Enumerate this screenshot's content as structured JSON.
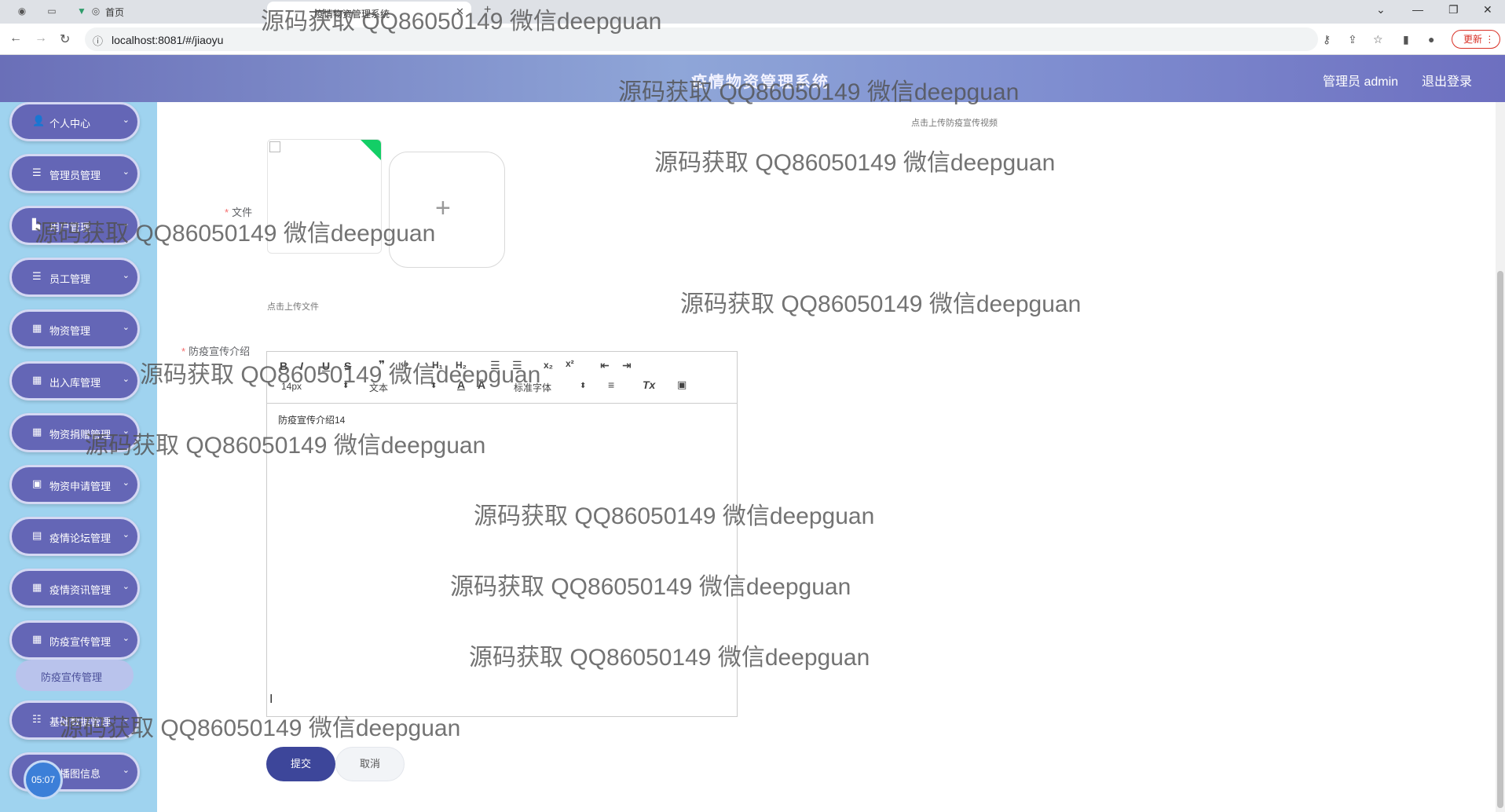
{
  "browser": {
    "tab_home_title": "首页",
    "tab_active_title": "疫情物资管理系统",
    "url": "localhost:8081/#/jiaoyu",
    "update_label": "更新"
  },
  "header": {
    "title": "疫情物资管理系统",
    "user_label": "管理员 admin",
    "logout_label": "退出登录"
  },
  "sidebar": {
    "items": [
      {
        "label": "个人中心",
        "icon": "user-icon"
      },
      {
        "label": "管理员管理",
        "icon": "list-icon"
      },
      {
        "label": "用户管理",
        "icon": "chart-icon"
      },
      {
        "label": "员工管理",
        "icon": "list-icon"
      },
      {
        "label": "物资管理",
        "icon": "grid-icon"
      },
      {
        "label": "出入库管理",
        "icon": "grid-icon"
      },
      {
        "label": "物资捐赠管理",
        "icon": "grid-icon"
      },
      {
        "label": "物资申请管理",
        "icon": "doc-icon"
      },
      {
        "label": "疫情论坛管理",
        "icon": "clipboard-icon"
      },
      {
        "label": "疫情资讯管理",
        "icon": "grid-icon"
      },
      {
        "label": "防疫宣传管理",
        "icon": "grid-icon"
      },
      {
        "label": "基础数据管理",
        "icon": "sliders-icon"
      },
      {
        "label": "轮播图信息",
        "icon": "grid-icon"
      }
    ],
    "submenu_active": "防疫宣传管理",
    "clock": "05:07"
  },
  "form": {
    "video_hint": "点击上传防疫宣传视频",
    "file_label": "文件",
    "file_hint": "点击上传文件",
    "intro_label": "防疫宣传介绍",
    "editor": {
      "font_size": "14px",
      "block_type": "文本",
      "font_family": "标准字体",
      "content": "防疫宣传介绍14"
    },
    "submit_label": "提交",
    "cancel_label": "取消"
  },
  "watermark": "源码获取 QQ86050149 微信deepguan"
}
